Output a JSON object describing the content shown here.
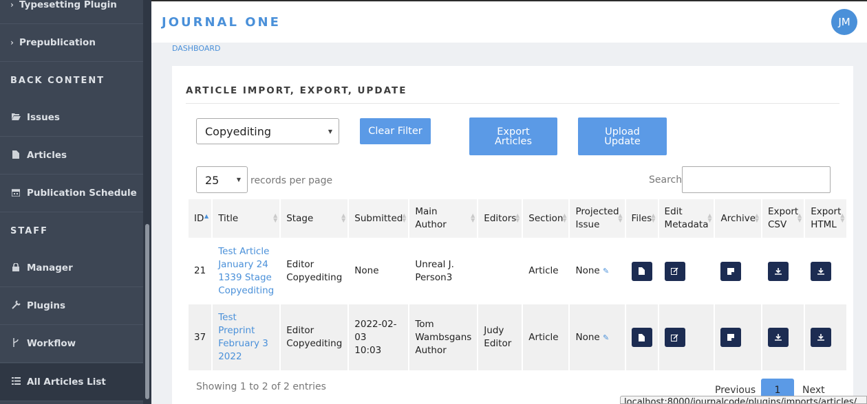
{
  "sidebar": {
    "items_top": [
      {
        "label": "Typesetting Plugin",
        "icon": "chevron-right-icon"
      },
      {
        "label": "Prepublication",
        "icon": "chevron-right-icon"
      }
    ],
    "back_content_heading": "BACK CONTENT",
    "back_content_items": [
      {
        "label": "Issues",
        "icon": "folder-open-icon"
      },
      {
        "label": "Articles",
        "icon": "file-icon"
      },
      {
        "label": "Publication Schedule",
        "icon": "calendar-icon"
      }
    ],
    "staff_heading": "STAFF",
    "staff_items": [
      {
        "label": "Manager",
        "icon": "lock-icon"
      },
      {
        "label": "Plugins",
        "icon": "plug-icon"
      },
      {
        "label": "Workflow",
        "icon": "code-fork-icon"
      },
      {
        "label": "All Articles List",
        "icon": "list-icon"
      }
    ]
  },
  "header": {
    "journal_title": "JOURNAL ONE",
    "avatar_initials": "JM"
  },
  "breadcrumb": "DASHBOARD",
  "card": {
    "title": "ARTICLE IMPORT, EXPORT, UPDATE",
    "stage_filter": "Copyediting",
    "clear_filter_label": "Clear Filter",
    "export_label_1": "Export",
    "export_label_2": "Articles",
    "upload_label_1": "Upload",
    "upload_label_2": "Update",
    "page_length": "25",
    "records_per_page_label": "records per page",
    "search_label": "Search:",
    "search_value": ""
  },
  "table": {
    "headers": {
      "id": "ID",
      "title": "Title",
      "stage": "Stage",
      "submitted": "Submitted",
      "main_author_1": "Main",
      "main_author_2": "Author",
      "editors": "Editors",
      "section": "Section",
      "projected_1": "Projected",
      "projected_2": "Issue",
      "files": "Files",
      "edit_metadata_1": "Edit",
      "edit_metadata_2": "Metadata",
      "archive": "Archive",
      "export_csv_1": "Export",
      "export_csv_2": "CSV",
      "export_html_1": "Export",
      "export_html_2": "HTML"
    },
    "rows": [
      {
        "id": "21",
        "title": [
          "Test Article",
          "January 24",
          "1339 Stage",
          "Copyediting"
        ],
        "stage": [
          "Editor",
          "Copyediting"
        ],
        "submitted": [
          "None",
          ""
        ],
        "author": [
          "Unreal J.",
          "Person3",
          ""
        ],
        "editors": [
          "",
          ""
        ],
        "section": "Article",
        "projected_issue": "None"
      },
      {
        "id": "37",
        "title": [
          "Test",
          "Preprint",
          "February 3",
          "2022"
        ],
        "stage": [
          "Editor",
          "Copyediting"
        ],
        "submitted": [
          "2022-02-03",
          "10:03"
        ],
        "author": [
          "Tom",
          "Wambsgans",
          "Author"
        ],
        "editors": [
          "Judy",
          "Editor"
        ],
        "section": "Article",
        "projected_issue": "None"
      }
    ]
  },
  "footer": {
    "info": "Showing 1 to 2 of 2 entries",
    "previous": "Previous",
    "current_page": "1",
    "next": "Next"
  },
  "status_bar_url": "localhost:8000/journalcode/plugins/imports/articles/",
  "colors": {
    "sidebar_bg": "#3d4654",
    "accent": "#4a90d9",
    "button_bg": "#5b9ae6",
    "icon_button_bg": "#1c2c52"
  }
}
